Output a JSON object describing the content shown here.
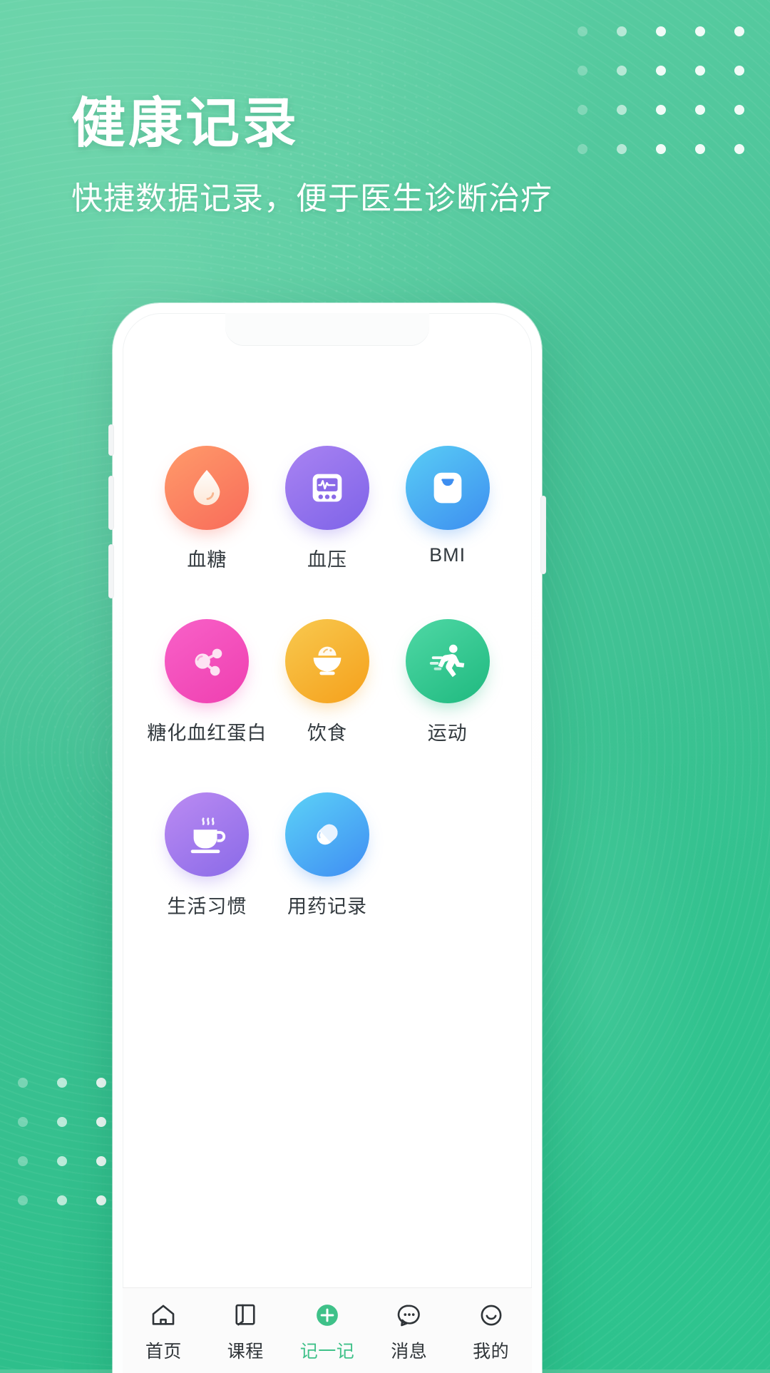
{
  "header": {
    "title": "健康记录",
    "subtitle": "快捷数据记录，便于医生诊断治疗"
  },
  "theme": {
    "background_start": "#5ecfa4",
    "background_end": "#25bd86",
    "accent": "#3fc189",
    "text_on_green": "#ffffff",
    "label_color": "#333a3f"
  },
  "phone": {
    "screen_background": "#ffffff"
  },
  "records": {
    "items": [
      {
        "label": "血糖",
        "icon": "blood-drop-icon",
        "color_start": "#ff9b6a",
        "color_end": "#f86b5a"
      },
      {
        "label": "血压",
        "icon": "blood-pressure-monitor-icon",
        "color_start": "#a983f2",
        "color_end": "#7e63e8"
      },
      {
        "label": "BMI",
        "icon": "weight-scale-icon",
        "color_start": "#59cdf5",
        "color_end": "#3d8ef0"
      },
      {
        "label": "糖化血红蛋白",
        "icon": "molecule-icon",
        "color_start": "#f861c8",
        "color_end": "#ef3fb0"
      },
      {
        "label": "饮食",
        "icon": "rice-bowl-icon",
        "color_start": "#f8c94f",
        "color_end": "#f5a01b"
      },
      {
        "label": "运动",
        "icon": "running-person-icon",
        "color_start": "#4fd8a5",
        "color_end": "#1fb97f"
      },
      {
        "label": "生活习惯",
        "icon": "coffee-cup-icon",
        "color_start": "#bb8bf2",
        "color_end": "#8a6ae8"
      },
      {
        "label": "用药记录",
        "icon": "pill-capsule-icon",
        "color_start": "#5cd2f7",
        "color_end": "#3f8df3"
      }
    ]
  },
  "tabbar": {
    "items": [
      {
        "label": "首页",
        "icon": "home-icon",
        "active": false
      },
      {
        "label": "课程",
        "icon": "book-icon",
        "active": false
      },
      {
        "label": "记一记",
        "icon": "plus-circle-icon",
        "active": true
      },
      {
        "label": "消息",
        "icon": "chat-bubble-icon",
        "active": false
      },
      {
        "label": "我的",
        "icon": "smiley-face-icon",
        "active": false
      }
    ]
  }
}
